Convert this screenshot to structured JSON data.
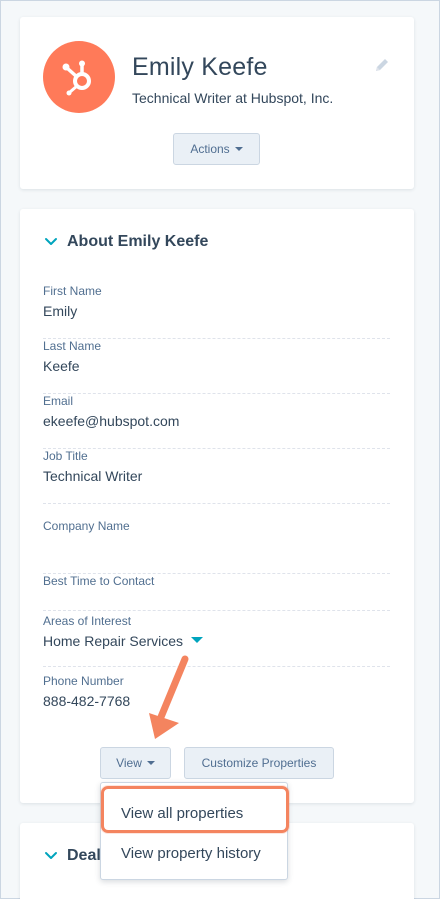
{
  "profile": {
    "name": "Emily Keefe",
    "title": "Technical Writer at Hubspot, Inc.",
    "actions_label": "Actions"
  },
  "about": {
    "section_title": "About Emily Keefe",
    "properties": [
      {
        "label": "First Name",
        "value": "Emily"
      },
      {
        "label": "Last Name",
        "value": "Keefe"
      },
      {
        "label": "Email",
        "value": "ekeefe@hubspot.com"
      },
      {
        "label": "Job Title",
        "value": "Technical Writer"
      },
      {
        "label": "Company Name",
        "value": ""
      },
      {
        "label": "Best Time to Contact",
        "value": ""
      },
      {
        "label": "Areas of Interest",
        "value": "Home Repair Services"
      },
      {
        "label": "Phone Number",
        "value": "888-482-7768"
      }
    ],
    "view_label": "View",
    "customize_label": "Customize Properties"
  },
  "view_menu": {
    "items": [
      "View all properties",
      "View property history"
    ]
  },
  "deals": {
    "section_title": "Deal"
  },
  "colors": {
    "brand": "#ff7a59",
    "accent": "#00a4bd",
    "highlight": "#f4845f"
  }
}
